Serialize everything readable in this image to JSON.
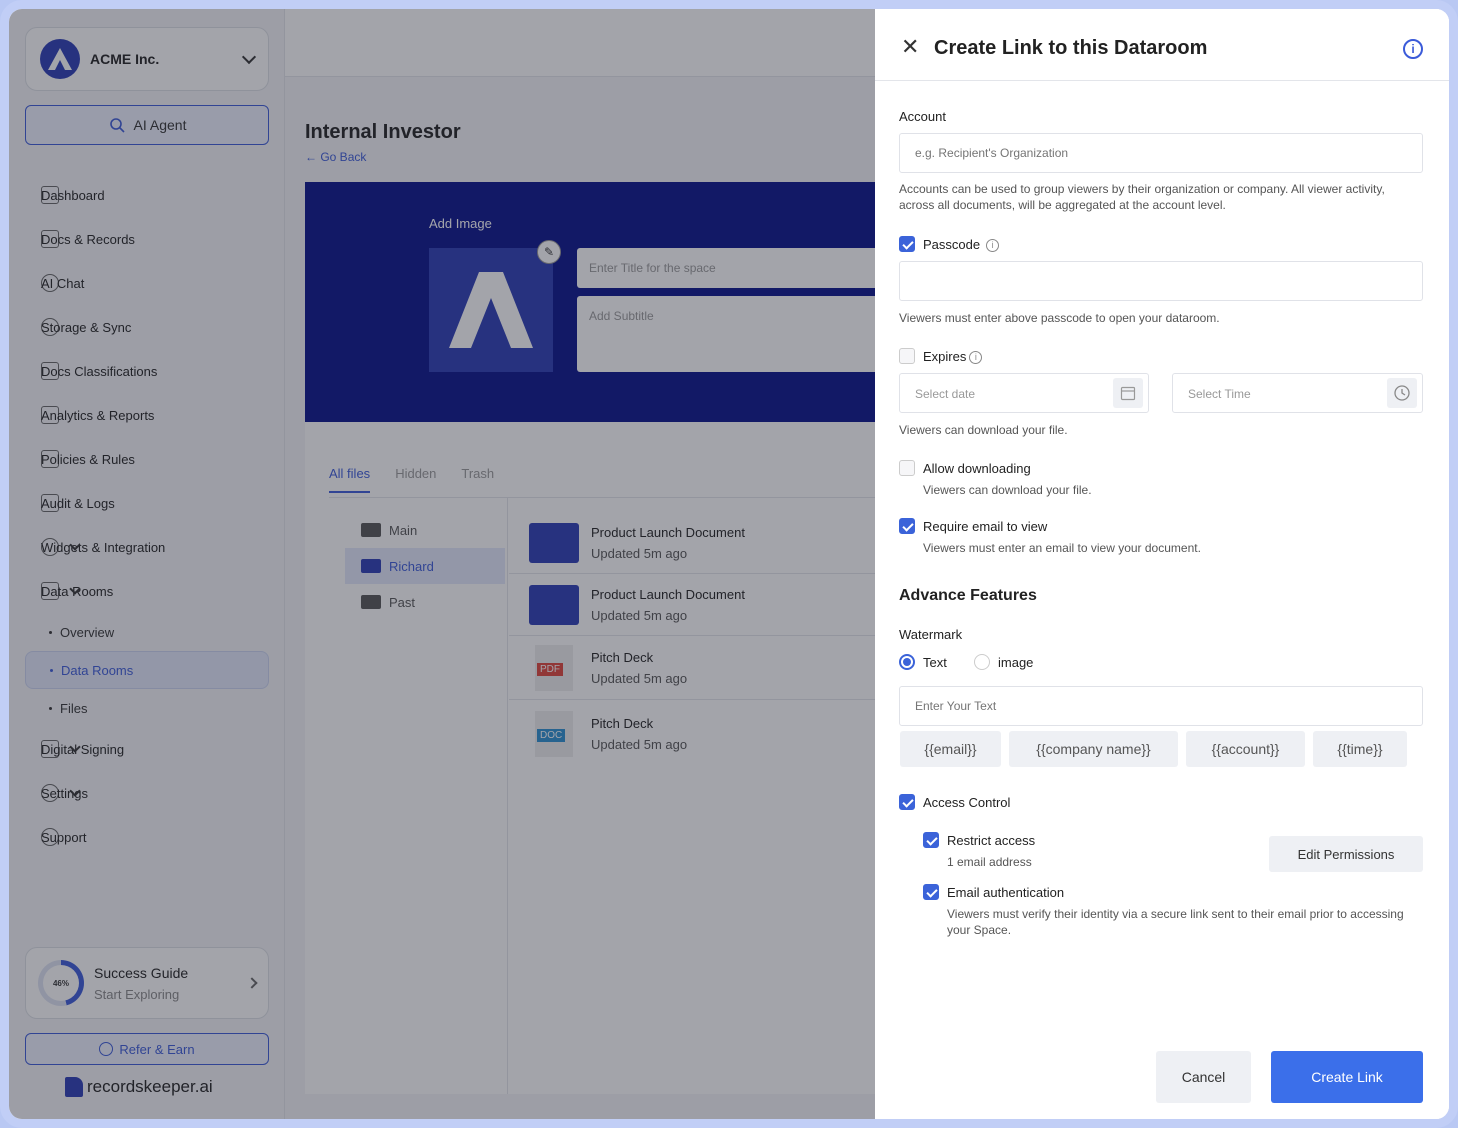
{
  "sidebar": {
    "org_name": "ACME Inc.",
    "ai_agent_label": "AI Agent",
    "items": [
      {
        "label": "Dashboard"
      },
      {
        "label": "Docs & Records"
      },
      {
        "label": "AI Chat"
      },
      {
        "label": "Storage & Sync"
      },
      {
        "label": "Docs Classifications"
      },
      {
        "label": "Analytics & Reports"
      },
      {
        "label": "Policies & Rules"
      },
      {
        "label": "Audit & Logs"
      },
      {
        "label": "Widgets & Integration"
      },
      {
        "label": "Data Rooms"
      }
    ],
    "subitems": [
      {
        "label": "Overview"
      },
      {
        "label": "Data Rooms"
      },
      {
        "label": "Files"
      }
    ],
    "bottom_items": [
      {
        "label": "Digital Signing"
      },
      {
        "label": "Settings"
      },
      {
        "label": "Support"
      }
    ],
    "guide": {
      "title": "Success Guide",
      "subtitle": "Start Exploring",
      "progress": "46%"
    },
    "refer_label": "Refer & Earn",
    "brand": "recordskeeper.ai"
  },
  "main": {
    "title": "Internal Investor",
    "go_back": "Go Back",
    "add_image": "Add Image",
    "title_placeholder": "Enter Title for the space",
    "subtitle_placeholder": "Add Subtitle",
    "tabs": [
      {
        "label": "All files"
      },
      {
        "label": "Hidden"
      },
      {
        "label": "Trash"
      }
    ],
    "folders": [
      {
        "label": "Main"
      },
      {
        "label": "Richard"
      },
      {
        "label": "Past"
      }
    ],
    "files": [
      {
        "name": "Product Launch Document",
        "updated": "Updated 5m ago"
      },
      {
        "name": "Product Launch Document",
        "updated": "Updated 5m ago"
      },
      {
        "name": "Pitch Deck",
        "updated": "Updated 5m ago",
        "type": "PDF"
      },
      {
        "name": "Pitch Deck",
        "updated": "Updated 5m ago",
        "type": "DOC"
      }
    ]
  },
  "panel": {
    "title": "Create Link to this Dataroom",
    "account_label": "Account",
    "account_placeholder": "e.g. Recipient's Organization",
    "account_hint": "Accounts can be used to group viewers by their organization or company. All viewer activity, across all documents, will be aggregated at the account level.",
    "passcode_label": "Passcode",
    "passcode_hint": "Viewers must enter above passcode to open your dataroom.",
    "expires_label": "Expires",
    "date_placeholder": "Select date",
    "time_placeholder": "Select Time",
    "expires_hint": "Viewers can download your file.",
    "download_label": "Allow downloading",
    "download_hint": "Viewers can download your file.",
    "email_label": "Require email to view",
    "email_hint": "Viewers must enter an email to view your document.",
    "advance_title": "Advance Features",
    "watermark_label": "Watermark",
    "radio_text": "Text",
    "radio_image": "image",
    "watermark_placeholder": "Enter Your Text",
    "chips": [
      {
        "label": "{{email}}"
      },
      {
        "label": "{{company name}}"
      },
      {
        "label": "{{account}}"
      },
      {
        "label": "{{time}}"
      }
    ],
    "access_label": "Access Control",
    "restrict_label": "Restrict access",
    "restrict_hint": "1 email address",
    "edit_permissions": "Edit Permissions",
    "auth_label": "Email authentication",
    "auth_hint": "Viewers must verify their identity via a secure link sent to their email prior to accessing your Space.",
    "cancel": "Cancel",
    "create": "Create Link"
  },
  "colors": {
    "accent": "#3b63d9",
    "banner": "#06108a"
  }
}
